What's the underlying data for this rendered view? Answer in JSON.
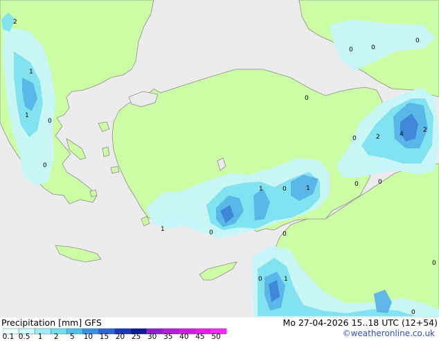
{
  "title_left": "Precipitation [mm]  GFS",
  "title_right": "Mo 27-04-2026 15..18 UTC (12+54)",
  "credit": "©weatheronline.co.uk",
  "colors": {
    "sea": "#ececec",
    "land": "#ccfca5",
    "coast": "#8d8d8d",
    "precip_light": "#c6f6f8",
    "precip_mid": "#7fe0ee",
    "precip_heavy": "#5ab4e8",
    "precip_core": "#3f84d6"
  },
  "legend": {
    "ticks": [
      "0.1",
      "0.5",
      "1",
      "2",
      "5",
      "10",
      "15",
      "20",
      "25",
      "30",
      "35",
      "40",
      "45",
      "50"
    ],
    "colors": [
      "#e6ffff",
      "#c8f7f8",
      "#a0ecf2",
      "#78dcec",
      "#55bdec",
      "#3b92e0",
      "#2d66d0",
      "#1a37b8",
      "#0e1a96",
      "#8a1ec8",
      "#b01ed8",
      "#d01ee0",
      "#e61ee8",
      "#f22cf0"
    ]
  },
  "map_labels": [
    "2",
    "1",
    "1",
    "0",
    "0",
    "0",
    "0",
    "0",
    "0",
    "0",
    "2",
    "4",
    "2",
    "0",
    "0",
    "1",
    "0",
    "1",
    "1",
    "0",
    "0",
    "0",
    "1",
    "0",
    "0"
  ]
}
